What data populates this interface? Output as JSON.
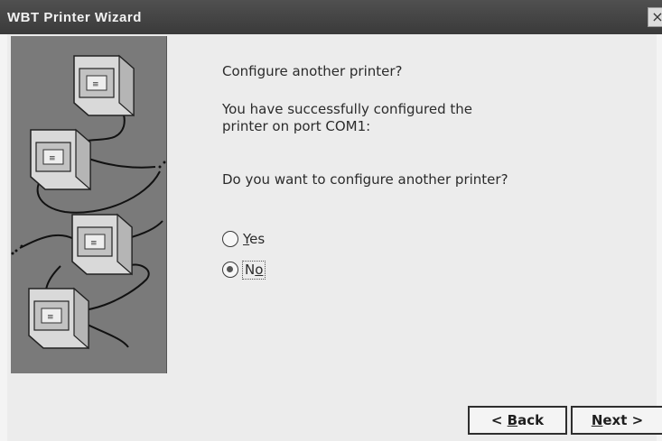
{
  "window": {
    "title": "WBT Printer Wizard",
    "close_symbol": "×"
  },
  "content": {
    "heading": "Configure another printer?",
    "message_line1": "You have successfully configured the printer on port COM1:",
    "message_line2": "Do you want to configure another printer?"
  },
  "options": {
    "yes": {
      "label_prefix": "",
      "accel": "Y",
      "label_rest": "es",
      "checked": false
    },
    "no": {
      "label_prefix": "",
      "accel": "N",
      "label_rest": "o",
      "checked": true
    }
  },
  "buttons": {
    "back": {
      "prefix": "< ",
      "accel": "B",
      "rest": "ack"
    },
    "next": {
      "prefix": "",
      "accel": "N",
      "rest": "ext >"
    }
  },
  "colors": {
    "titlebar": "#3a3a3a",
    "side_panel": "#7a7a7a",
    "dialog_bg": "#ececec"
  },
  "icons": [
    "computer-monitor-icon",
    "close-icon"
  ]
}
